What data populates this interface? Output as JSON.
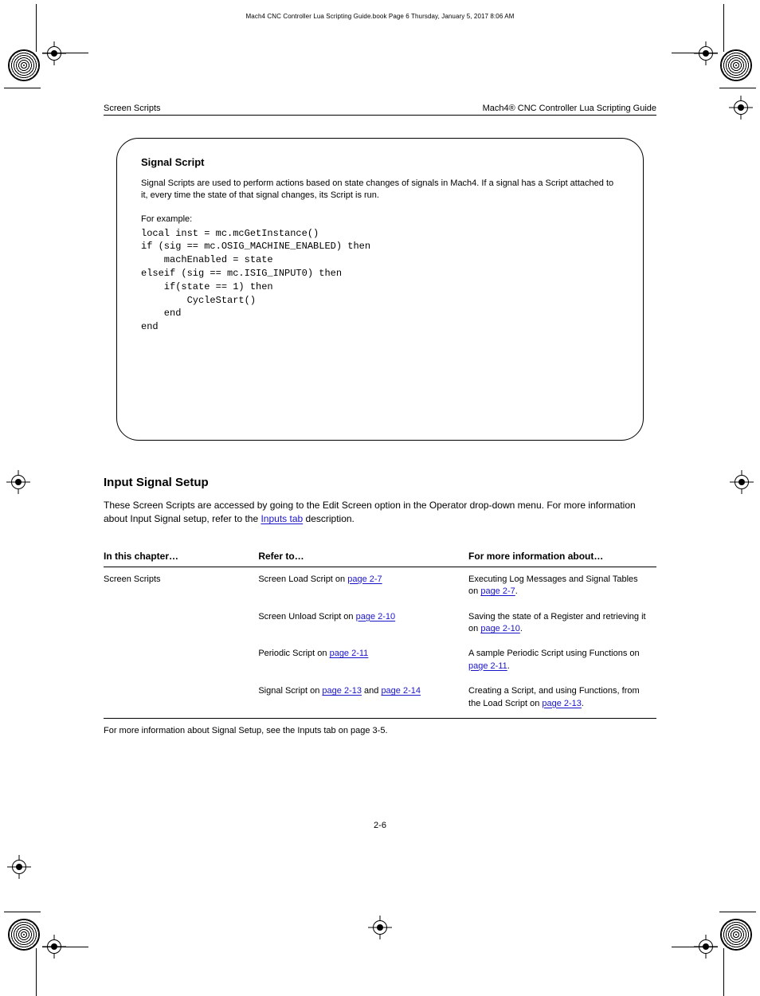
{
  "running_head": "Mach4 CNC Controller Lua Scripting Guide.book  Page 6  Thursday, January 5, 2017  8:06 AM",
  "header": {
    "left": "Screen Scripts",
    "right": "Mach4® CNC Controller Lua Scripting Guide"
  },
  "panel": {
    "title": "Signal Script",
    "desc": "Signal Scripts are used to perform actions based on state changes of signals in Mach4. If a signal has a Script attached to it, every time the state of that signal changes, its Script is run.",
    "example_label": "For example:",
    "code": "local inst = mc.mcGetInstance()\nif (sig == mc.OSIG_MACHINE_ENABLED) then\n    machEnabled = state\nelseif (sig == mc.ISIG_INPUT0) then\n    if(state == 1) then\n        CycleStart()\n    end\nend"
  },
  "subheading": "Input Signal Setup",
  "para_pre": "These Screen Scripts are accessed by going to the Edit Screen option in the Operator drop-down menu. For more information about Input Signal setup, refer to the ",
  "para_link": "Inputs tab",
  "para_post": " description.",
  "table": {
    "headers": [
      "In this chapter…",
      "Refer to…",
      "For more information about…"
    ],
    "rows": [
      {
        "c1": "Screen Scripts",
        "c2": "Screen Load Script on page 2-7",
        "link2": "page 2-7",
        "c3": "Executing Log Messages and Signal Tables on page 2-7.",
        "link3": "page 2-7"
      },
      {
        "c1": "",
        "c2": "Screen Unload Script on page 2-10",
        "link2": "page 2-10",
        "c3": "Saving the state of a Register and retrieving it on page 2-10.",
        "link3": "page 2-10"
      },
      {
        "c1": "",
        "c2": "Periodic Script on page 2-11",
        "link2": "page 2-11",
        "c3": "A sample Periodic Script using Functions on page 2-11.",
        "link3": "page 2-11"
      },
      {
        "c1": "",
        "c2": "Signal Script on page 2-13 and page 2-14",
        "link2": "page 2-13",
        "link2b": "page 2-14",
        "c3": "Creating a Script, and using Functions, from the Load Script on page 2-13.",
        "link3": "page 2-13"
      }
    ],
    "footer": "For more information about Signal Setup, see the Inputs tab on page 3-5."
  },
  "page_number": "2-6"
}
